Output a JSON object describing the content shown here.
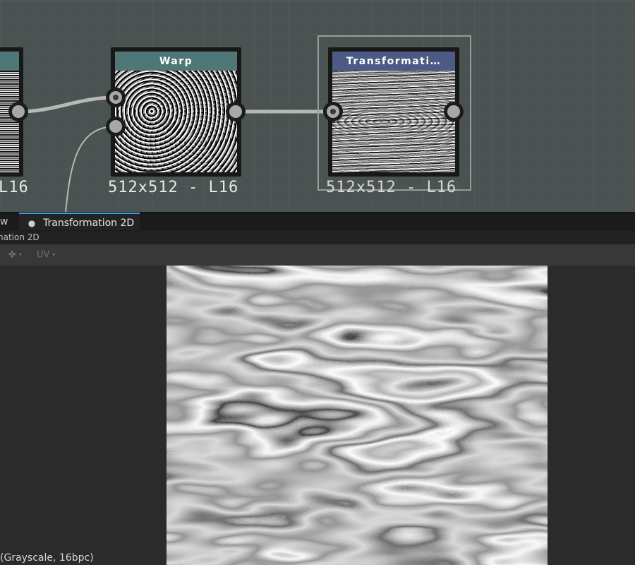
{
  "graph": {
    "left_node": {
      "resolution": "L16"
    },
    "warp_node": {
      "title": "Warp",
      "header_color": "#4f7778",
      "resolution": "512x512 - L16"
    },
    "transform_node": {
      "title": "Transformati…",
      "header_color": "#4b5b86",
      "resolution": "512x512 - L16",
      "selected": true
    }
  },
  "panel": {
    "tabs": [
      {
        "label": "w",
        "icon": "",
        "active": false
      },
      {
        "label": "Transformation 2D",
        "icon": "node-icon",
        "active": true
      }
    ],
    "subtitle": "nation 2D",
    "toolbar": {
      "channels_icon": "channels-icon",
      "uv_label": "UV"
    },
    "status": "(Grayscale, 16bpc)",
    "accent_color": "#3aa0e0"
  }
}
